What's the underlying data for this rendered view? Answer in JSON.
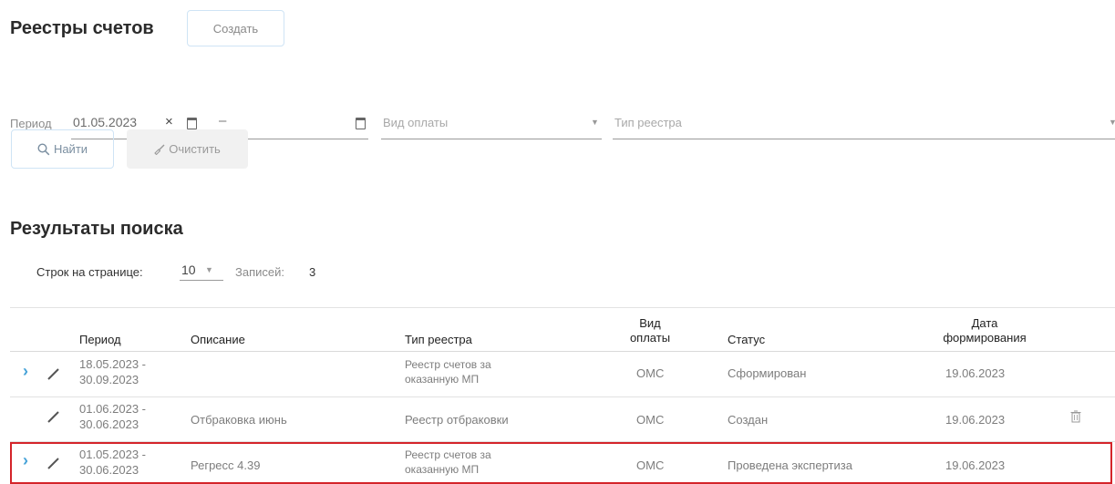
{
  "header": {
    "title": "Реестры счетов",
    "create_label": "Создать"
  },
  "filters": {
    "period_label": "Период",
    "date_from": "01.05.2023",
    "clear_symbol": "×",
    "dash": "–",
    "date_to": "",
    "payment_type_placeholder": "Вид оплаты",
    "registry_type_placeholder": "Тип реестра",
    "find_label": "Найти",
    "clear_label": "Очистить"
  },
  "results": {
    "title": "Результаты поиска",
    "rows_per_page_label": "Строк на странице:",
    "rows_per_page": "10",
    "records_label": "Записей:",
    "records_count": "3"
  },
  "table": {
    "columns": {
      "period": "Период",
      "description": "Описание",
      "registry_type": "Тип реестра",
      "payment_type_line1": "Вид",
      "payment_type_line2": "оплаты",
      "status": "Статус",
      "date_line1": "Дата",
      "date_line2": "формирования"
    },
    "rows": [
      {
        "period_start": "18.05.2023 -",
        "period_end": "30.09.2023",
        "description": "",
        "type_line1": "Реестр счетов за",
        "type_line2": "оказанную МП",
        "payment": "ОМС",
        "status": "Сформирован",
        "date": "19.06.2023",
        "expandable": true,
        "deletable": false,
        "selected": false
      },
      {
        "period_start": "01.06.2023 -",
        "period_end": "30.06.2023",
        "description": "Отбраковка июнь",
        "type_line1": "Реестр отбраковки",
        "type_line2": "",
        "payment": "ОМС",
        "status": "Создан",
        "date": "19.06.2023",
        "expandable": false,
        "deletable": true,
        "selected": false
      },
      {
        "period_start": "01.05.2023 -",
        "period_end": "30.06.2023",
        "description": "Регресс 4.39",
        "type_line1": "Реестр счетов за",
        "type_line2": "оказанную МП",
        "payment": "ОМС",
        "status": "Проведена экспертиза",
        "date": "19.06.2023",
        "expandable": true,
        "deletable": false,
        "selected": true
      }
    ]
  },
  "icons": [
    "search-icon",
    "broom-icon",
    "calendar-icon",
    "chevron-down-icon",
    "expand-icon",
    "edit-icon",
    "trash-icon"
  ],
  "colors": {
    "accent": "#47a3d8",
    "selection_border": "#d4242a"
  }
}
